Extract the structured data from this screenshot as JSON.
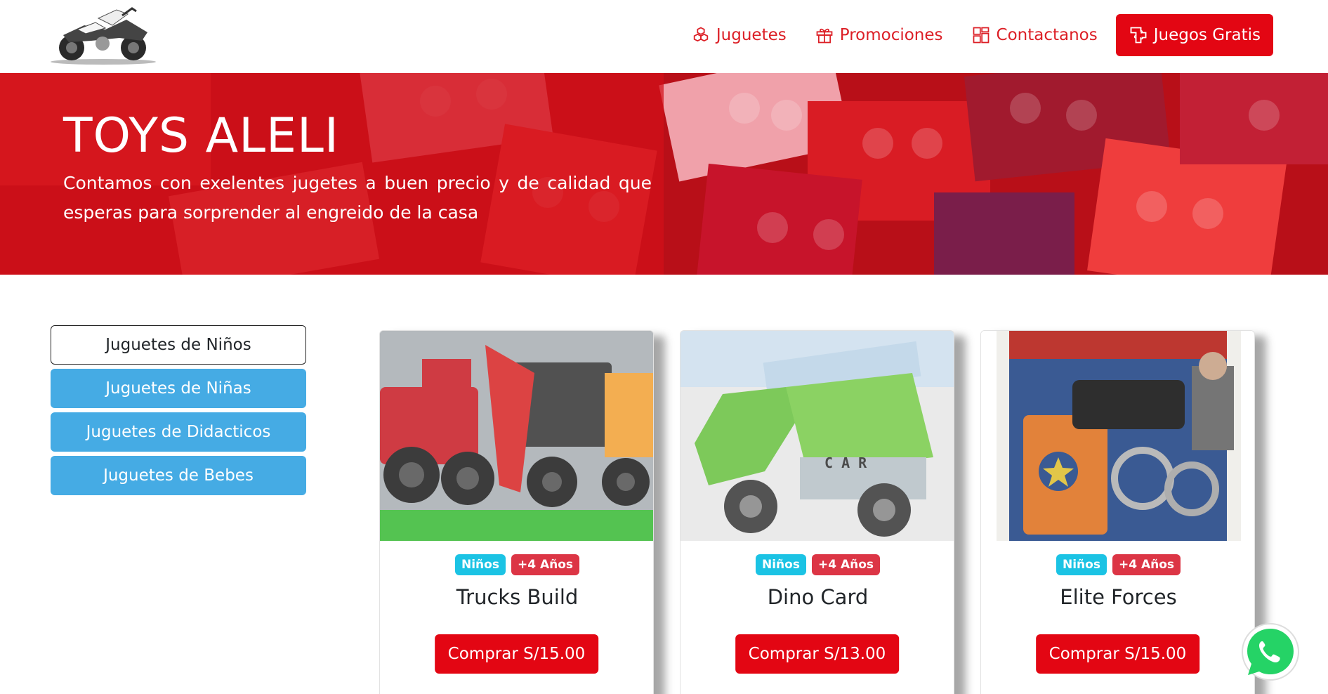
{
  "nav": {
    "logo_alt": "quad bike logo",
    "links": [
      {
        "label": "Juguetes",
        "icon": "blocks-icon"
      },
      {
        "label": "Promociones",
        "icon": "gift-icon"
      },
      {
        "label": "Contactanos",
        "icon": "grid-icon"
      }
    ],
    "cta": {
      "label": "Juegos Gratis",
      "icon": "puzzle-icon"
    }
  },
  "hero": {
    "title": "TOYS ALELI",
    "text": "Contamos con exelentes jugetes a buen precio y de calidad que esperas para sorprender al engreido de la casa"
  },
  "sidebar": {
    "categories": [
      {
        "label": "Juguetes de Niños",
        "active": true
      },
      {
        "label": "Juguetes de Niñas",
        "active": false
      },
      {
        "label": "Juguetes de Didacticos",
        "active": false
      },
      {
        "label": "Juguetes de Bebes",
        "active": false
      }
    ]
  },
  "products": [
    {
      "title": "Trucks Build",
      "badge_gender": "Niños",
      "badge_age": "+4 Años",
      "buy_label": "Comprar S/15.00"
    },
    {
      "title": "Dino Card",
      "badge_gender": "Niños",
      "badge_age": "+4 Años",
      "buy_label": "Comprar S/13.00"
    },
    {
      "title": "Elite Forces",
      "badge_gender": "Niños",
      "badge_age": "+4 Años",
      "buy_label": "Comprar S/15.00"
    }
  ],
  "colors": {
    "accent_red": "#e30613",
    "link_red": "#dc1f26",
    "category_blue": "#45abe4",
    "badge_blue": "#1bc3e4",
    "badge_red": "#dc3545"
  }
}
